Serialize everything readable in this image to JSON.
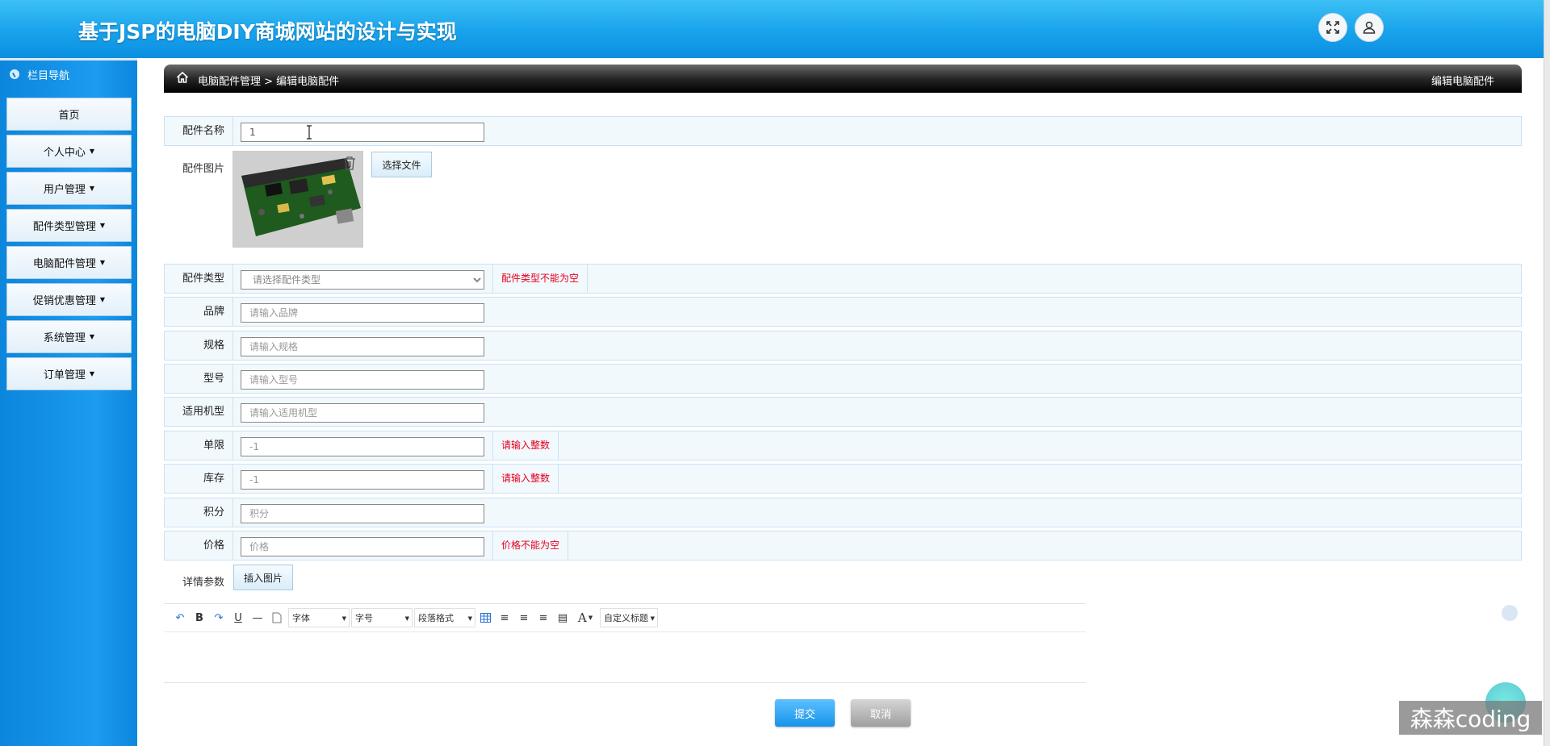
{
  "header": {
    "title": "基于JSP的电脑DIY商城网站的设计与实现"
  },
  "sidebar": {
    "nav_title": "栏目导航",
    "items": [
      {
        "label": "首页",
        "has_caret": false
      },
      {
        "label": "个人中心",
        "has_caret": true
      },
      {
        "label": "用户管理",
        "has_caret": true
      },
      {
        "label": "配件类型管理",
        "has_caret": true
      },
      {
        "label": "电脑配件管理",
        "has_caret": true
      },
      {
        "label": "促销优惠管理",
        "has_caret": true
      },
      {
        "label": "系统管理",
        "has_caret": true
      },
      {
        "label": "订单管理",
        "has_caret": true
      }
    ]
  },
  "breadcrumb": {
    "path": "电脑配件管理 > 编辑电脑配件",
    "right_title": "编辑电脑配件"
  },
  "form": {
    "name": {
      "label": "配件名称",
      "value": "1"
    },
    "image": {
      "label": "配件图片",
      "choose_button": "选择文件"
    },
    "type": {
      "label": "配件类型",
      "placeholder": "请选择配件类型",
      "error": "配件类型不能为空"
    },
    "brand": {
      "label": "品牌",
      "placeholder": "请输入品牌"
    },
    "spec": {
      "label": "规格",
      "placeholder": "请输入规格"
    },
    "model": {
      "label": "型号",
      "placeholder": "请输入型号"
    },
    "fit": {
      "label": "适用机型",
      "placeholder": "请输入适用机型"
    },
    "limit": {
      "label": "单限",
      "value": "-1",
      "error": "请输入整数"
    },
    "stock": {
      "label": "库存",
      "value": "-1",
      "error": "请输入整数"
    },
    "points": {
      "label": "积分",
      "placeholder": "积分"
    },
    "price": {
      "label": "价格",
      "placeholder": "价格",
      "error": "价格不能为空"
    },
    "detail": {
      "label": "详情参数",
      "insert_button": "插入图片"
    }
  },
  "editor": {
    "bold": "B",
    "underline": "U",
    "font_color": "A",
    "font_family": "字体",
    "font_size": "字号",
    "paragraph": "段落格式",
    "custom_title": "自定义标题"
  },
  "actions": {
    "submit": "提交",
    "cancel": "取消"
  },
  "watermark": "森森coding",
  "colors": {
    "header_blue": "#18a2ec",
    "sidebar_blue": "#1c9bf0",
    "error_red": "#e6001e",
    "submit_blue": "#1593e9"
  }
}
